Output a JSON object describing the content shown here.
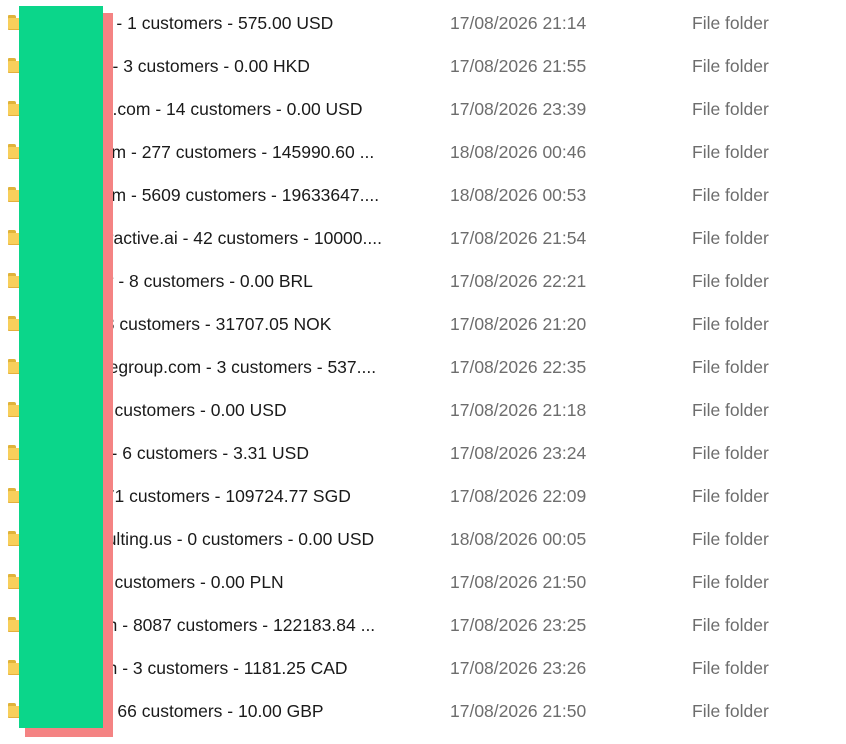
{
  "rows": [
    {
      "name": "ia.com - 1 customers - 575.00 USD",
      "date": "17/08/2026 21:14",
      "type": "File folder",
      "icon": "folder-icon"
    },
    {
      "name": "9.com - 3 customers - 0.00 HKD",
      "date": "17/08/2026 21:55",
      "type": "File folder",
      "icon": "folder-icon"
    },
    {
      "name": "inghub.com - 14 customers - 0.00 USD",
      "date": "17/08/2026 23:39",
      "type": "File folder",
      "icon": "folder-icon"
    },
    {
      "name": "tina.com - 277 customers - 145990.60 ...",
      "date": "18/08/2026 00:46",
      "type": "File folder",
      "icon": "folder-icon"
    },
    {
      "name": "tina.com - 5609 customers - 19633647....",
      "date": "18/08/2026 00:53",
      "type": "File folder",
      "icon": "folder-icon"
    },
    {
      "name": "neinteractive.ai - 42 customers - 10000....",
      "date": "17/08/2026 21:54",
      "type": "File folder",
      "icon": "folder-icon"
    },
    {
      "name": "com.br - 8 customers - 0.00 BRL",
      "date": "17/08/2026 22:21",
      "type": "File folder",
      "icon": "folder-icon"
    },
    {
      "name": "o - 338 customers - 31707.05 NOK",
      "date": "17/08/2026 21:20",
      "type": "File folder",
      "icon": "folder-icon"
    },
    {
      "name": "nmercegroup.com - 3 customers - 537....",
      "date": "17/08/2026 22:35",
      "type": "File folder",
      "icon": "folder-icon"
    },
    {
      "name": "om - 0 customers - 0.00 USD",
      "date": "17/08/2026 21:18",
      "type": "File folder",
      "icon": "folder-icon"
    },
    {
      "name": "x.com - 6 customers - 3.31 USD",
      "date": "17/08/2026 23:24",
      "type": "File folder",
      "icon": "folder-icon"
    },
    {
      "name": "a - 2571 customers - 109724.77 SGD",
      "date": "17/08/2026 22:09",
      "type": "File folder",
      "icon": "folder-icon"
    },
    {
      "name": "nconsulting.us - 0 customers - 0.00 USD",
      "date": "18/08/2026 00:05",
      "type": "File folder",
      "icon": "folder-icon"
    },
    {
      "name": "om - 6 customers - 0.00 PLN",
      "date": "17/08/2026 21:50",
      "type": "File folder",
      "icon": "folder-icon"
    },
    {
      "name": "ub.com - 8087 customers - 122183.84 ...",
      "date": "17/08/2026 23:25",
      "type": "File folder",
      "icon": "folder-icon"
    },
    {
      "name": "oft.com - 3 customers - 1181.25 CAD",
      "date": "17/08/2026 23:26",
      "type": "File folder",
      "icon": "folder-icon"
    },
    {
      "name": "co.uk - 66 customers - 10.00 GBP",
      "date": "17/08/2026 21:50",
      "type": "File folder",
      "icon": "folder-icon"
    }
  ],
  "colors": {
    "redaction": "#0bd68a",
    "redaction_shadow": "#f48383",
    "folder": "#f8cf5b",
    "name_text": "#1a1a1a",
    "secondary_text": "#6d6d6d"
  }
}
